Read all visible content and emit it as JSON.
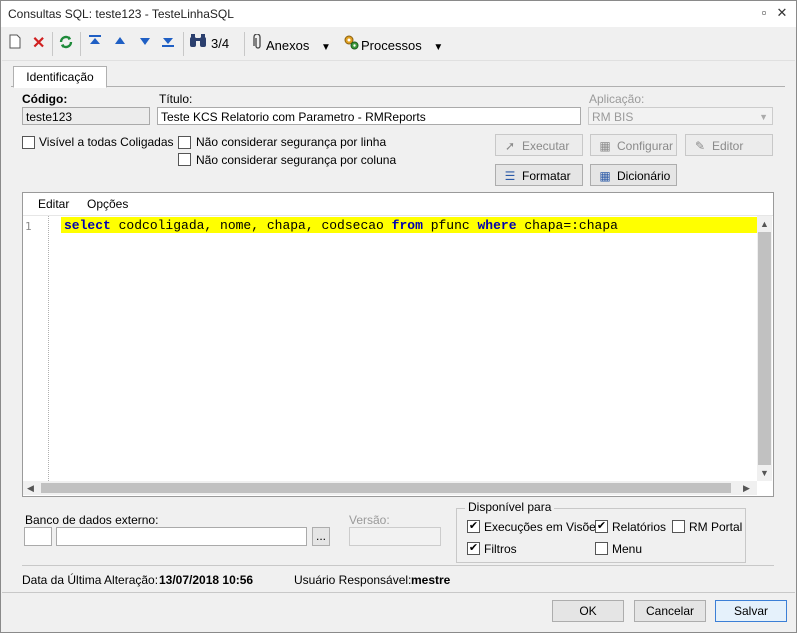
{
  "window": {
    "title": "Consultas SQL: teste123 - TesteLinhaSQL"
  },
  "toolbar": {
    "record_counter": "3/4",
    "anexos_label": "Anexos",
    "processos_label": "Processos"
  },
  "tabs": [
    {
      "label": "Identificação"
    }
  ],
  "form": {
    "codigo_label": "Código:",
    "codigo_value": "teste123",
    "titulo_label": "Título:",
    "titulo_value": "Teste KCS Relatorio com Parametro - RMReports",
    "aplicacao_label": "Aplicação:",
    "aplicacao_value": "RM BIS",
    "visivel_coligadas_label": "Visível a todas Coligadas",
    "nao_seg_linha_label": "Não considerar segurança por linha",
    "nao_seg_coluna_label": "Não considerar segurança por coluna"
  },
  "actions": {
    "executar": "Executar",
    "configurar": "Configurar",
    "editor": "Editor",
    "formatar": "Formatar",
    "dicionario": "Dicionário"
  },
  "editor": {
    "menu": {
      "editar": "Editar",
      "opcoes": "Opções"
    },
    "line_number": "1",
    "code_tokens": [
      {
        "text": "select",
        "kw": true
      },
      {
        "text": " codcoligada, nome, chapa, codsecao ",
        "kw": false
      },
      {
        "text": "from",
        "kw": true
      },
      {
        "text": " pfunc ",
        "kw": false
      },
      {
        "text": "where",
        "kw": true
      },
      {
        "text": " chapa=:chapa",
        "kw": false
      }
    ]
  },
  "bottom": {
    "banco_externo_label": "Banco de dados externo:",
    "banco_browse_label": "...",
    "versao_label": "Versão:",
    "disponivel_label": "Disponível para",
    "execucoes_visoes_label": "Execuções em Visões",
    "relatorios_label": "Relatórios",
    "rm_portal_label": "RM Portal",
    "filtros_label": "Filtros",
    "menu_label": "Menu",
    "execucoes_visoes_checked": true,
    "relatorios_checked": true,
    "rm_portal_checked": false,
    "filtros_checked": true,
    "menu_checked": false
  },
  "status": {
    "ultima_alteracao_label": "Data da Última Alteração:",
    "ultima_alteracao_value": "13/07/2018 10:56",
    "usuario_label": "Usuário Responsável:",
    "usuario_value": "mestre"
  },
  "footer": {
    "ok_label": "OK",
    "cancelar_label": "Cancelar",
    "salvar_label": "Salvar"
  }
}
